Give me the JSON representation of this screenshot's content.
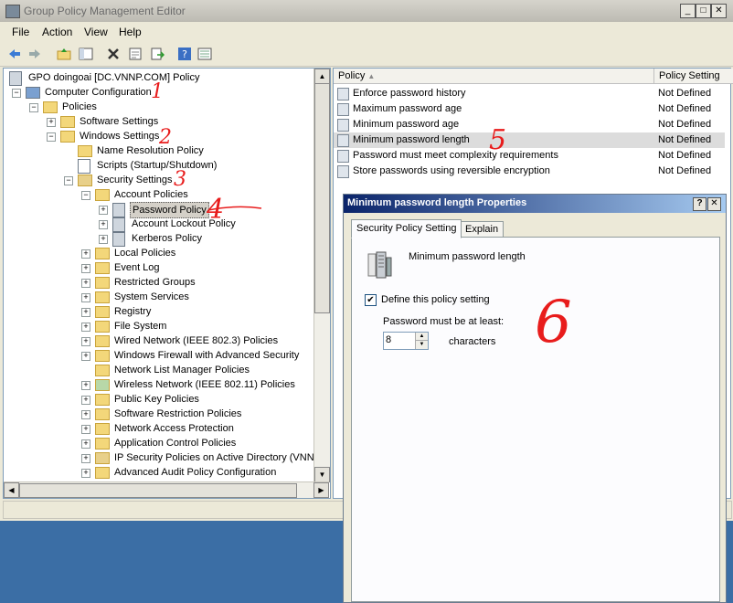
{
  "window": {
    "title": "Group Policy Management Editor"
  },
  "menu": [
    "File",
    "Action",
    "View",
    "Help"
  ],
  "tree": [
    {
      "label": "GPO doingoai [DC.VNNP.COM] Policy",
      "indent": 0,
      "exp": "",
      "icon": "policy"
    },
    {
      "label": "Computer Configuration",
      "indent": 1,
      "exp": "−",
      "icon": "computer"
    },
    {
      "label": "Policies",
      "indent": 2,
      "exp": "−",
      "icon": "folder"
    },
    {
      "label": "Software Settings",
      "indent": 3,
      "exp": "+",
      "icon": "folder"
    },
    {
      "label": "Windows Settings",
      "indent": 3,
      "exp": "−",
      "icon": "folder"
    },
    {
      "label": "Name Resolution Policy",
      "indent": 4,
      "exp": "",
      "icon": "folder"
    },
    {
      "label": "Scripts (Startup/Shutdown)",
      "indent": 4,
      "exp": "",
      "icon": "doc"
    },
    {
      "label": "Security Settings",
      "indent": 4,
      "exp": "−",
      "icon": "shield"
    },
    {
      "label": "Account Policies",
      "indent": 5,
      "exp": "−",
      "icon": "folder"
    },
    {
      "label": "Password Policy",
      "indent": 6,
      "exp": "+",
      "icon": "policy",
      "selected": true
    },
    {
      "label": "Account Lockout Policy",
      "indent": 6,
      "exp": "+",
      "icon": "policy"
    },
    {
      "label": "Kerberos Policy",
      "indent": 6,
      "exp": "+",
      "icon": "policy"
    },
    {
      "label": "Local Policies",
      "indent": 5,
      "exp": "+",
      "icon": "folder"
    },
    {
      "label": "Event Log",
      "indent": 5,
      "exp": "+",
      "icon": "folder"
    },
    {
      "label": "Restricted Groups",
      "indent": 5,
      "exp": "+",
      "icon": "folder"
    },
    {
      "label": "System Services",
      "indent": 5,
      "exp": "+",
      "icon": "folder"
    },
    {
      "label": "Registry",
      "indent": 5,
      "exp": "+",
      "icon": "folder"
    },
    {
      "label": "File System",
      "indent": 5,
      "exp": "+",
      "icon": "folder"
    },
    {
      "label": "Wired Network (IEEE 802.3) Policies",
      "indent": 5,
      "exp": "+",
      "icon": "folder"
    },
    {
      "label": "Windows Firewall with Advanced Security",
      "indent": 5,
      "exp": "+",
      "icon": "folder"
    },
    {
      "label": "Network List Manager Policies",
      "indent": 5,
      "exp": "",
      "icon": "folder"
    },
    {
      "label": "Wireless Network (IEEE 802.11) Policies",
      "indent": 5,
      "exp": "+",
      "icon": "chart"
    },
    {
      "label": "Public Key Policies",
      "indent": 5,
      "exp": "+",
      "icon": "folder"
    },
    {
      "label": "Software Restriction Policies",
      "indent": 5,
      "exp": "+",
      "icon": "folder"
    },
    {
      "label": "Network Access Protection",
      "indent": 5,
      "exp": "+",
      "icon": "folder"
    },
    {
      "label": "Application Control Policies",
      "indent": 5,
      "exp": "+",
      "icon": "folder"
    },
    {
      "label": "IP Security Policies on Active Directory (VNNP",
      "indent": 5,
      "exp": "+",
      "icon": "shield"
    },
    {
      "label": "Advanced Audit Policy Configuration",
      "indent": 5,
      "exp": "+",
      "icon": "folder"
    }
  ],
  "list": {
    "headers": {
      "policy": "Policy",
      "setting": "Policy Setting"
    },
    "rows": [
      {
        "policy": "Enforce password history",
        "setting": "Not Defined"
      },
      {
        "policy": "Maximum password age",
        "setting": "Not Defined"
      },
      {
        "policy": "Minimum password age",
        "setting": "Not Defined"
      },
      {
        "policy": "Minimum password length",
        "setting": "Not Defined",
        "selected": true
      },
      {
        "policy": "Password must meet complexity requirements",
        "setting": "Not Defined"
      },
      {
        "policy": "Store passwords using reversible encryption",
        "setting": "Not Defined"
      }
    ]
  },
  "dialog": {
    "title": "Minimum password length Properties",
    "tabs": [
      "Security Policy Setting",
      "Explain"
    ],
    "heading": "Minimum password length",
    "define_label": "Define this policy setting",
    "define_checked": true,
    "must_be_label": "Password must be at least:",
    "value": "8",
    "unit": "characters"
  },
  "annotations": [
    "1",
    "2",
    "3",
    "4",
    "5",
    "6"
  ]
}
